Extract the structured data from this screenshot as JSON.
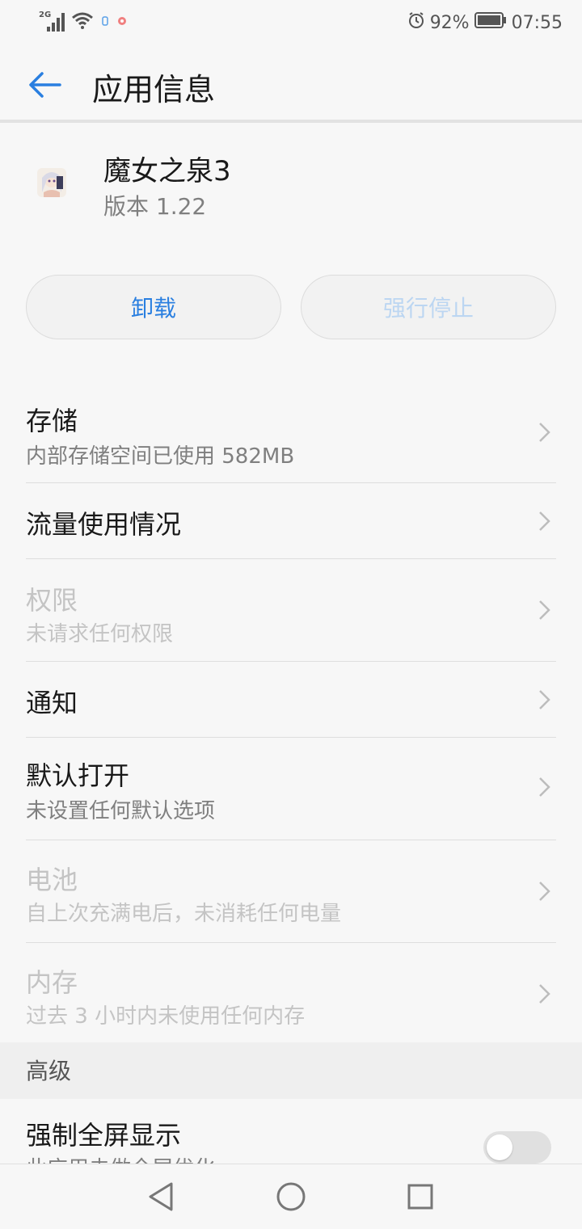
{
  "status_bar": {
    "network": "2G",
    "battery": "92%",
    "time": "07:55"
  },
  "header": {
    "title": "应用信息"
  },
  "app": {
    "name": "魔女之泉3",
    "version": "版本 1.22"
  },
  "actions": {
    "uninstall": "卸载",
    "force_stop": "强行停止"
  },
  "settings": {
    "items": [
      {
        "title": "存储",
        "subtitle": "内部存储空间已使用 582MB",
        "enabled": true
      },
      {
        "title": "流量使用情况",
        "subtitle": "",
        "enabled": true
      },
      {
        "title": "权限",
        "subtitle": "未请求任何权限",
        "enabled": false
      },
      {
        "title": "通知",
        "subtitle": "",
        "enabled": true
      },
      {
        "title": "默认打开",
        "subtitle": "未设置任何默认选项",
        "enabled": true
      },
      {
        "title": "电池",
        "subtitle": "自上次充满电后，未消耗任何电量",
        "enabled": false
      },
      {
        "title": "内存",
        "subtitle": "过去 3 小时内未使用任何内存",
        "enabled": false
      }
    ]
  },
  "advanced": {
    "section_title": "高级",
    "fullscreen_title": "强制全屏显示",
    "fullscreen_subtitle": "此应用未做全屏优化",
    "fullscreen_enabled": false
  },
  "colors": {
    "accent": "#2a7fe0",
    "disabled_text": "#c4c4c4"
  }
}
